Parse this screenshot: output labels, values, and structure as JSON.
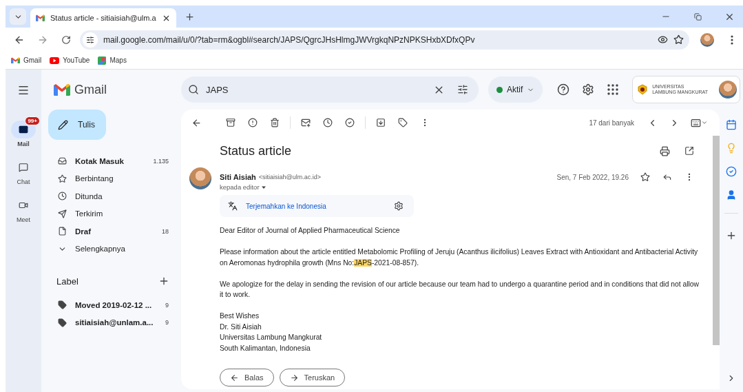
{
  "browser": {
    "tab_title": "Status article - sitiaisiah@ulm.a",
    "url": "mail.google.com/mail/u/0/?tab=rm&ogbl#search/JAPS/QgrcJHsHlmgJWVrgkqNPzNPKSHxbXDfxQPv",
    "bookmarks": [
      {
        "label": "Gmail",
        "kind": "gmail"
      },
      {
        "label": "YouTube",
        "kind": "youtube"
      },
      {
        "label": "Maps",
        "kind": "maps"
      }
    ]
  },
  "app": {
    "name": "Gmail"
  },
  "rail": [
    {
      "label": "Mail",
      "kind": "mail",
      "selected": true,
      "badge": "99+"
    },
    {
      "label": "Chat",
      "kind": "chat",
      "selected": false
    },
    {
      "label": "Meet",
      "kind": "meet",
      "selected": false
    }
  ],
  "compose": "Tulis",
  "folders": [
    {
      "label": "Kotak Masuk",
      "kind": "inbox",
      "count": "1.135",
      "unread": true
    },
    {
      "label": "Berbintang",
      "kind": "starred",
      "unread": false
    },
    {
      "label": "Ditunda",
      "kind": "snoozed",
      "unread": false
    },
    {
      "label": "Terkirim",
      "kind": "sent",
      "unread": false
    },
    {
      "label": "Draf",
      "kind": "drafts",
      "count": "18",
      "unread": true
    },
    {
      "label": "Selengkapnya",
      "kind": "more",
      "unread": false
    }
  ],
  "labels_heading": "Label",
  "labels": [
    {
      "label": "Moved 2019-02-12 ...",
      "count": "9",
      "unread": true
    },
    {
      "label": "sitiaisiah@unlam.a...",
      "count": "9",
      "unread": true
    }
  ],
  "search": {
    "value": "JAPS"
  },
  "status": {
    "label": "Aktif"
  },
  "org_logo": [
    "UNIVERSITAS",
    "LAMBUNG MANGKURAT"
  ],
  "thread": {
    "position": "17 dari banyak",
    "subject": "Status article"
  },
  "message": {
    "sender": "Siti Aisiah",
    "email": "<sitiaisiah@ulm.ac.id>",
    "to": "kepada editor",
    "date": "Sen, 7 Feb 2022, 19.26",
    "translate": "Terjemahkan ke Indonesia",
    "paragraphs": [
      [
        {
          "text": "Dear Editor of Journal of Applied Pharmaceutical Science",
          "highlight": false
        }
      ],
      [
        {
          "text": "Please information about the article entitled Metabolomic Profiling of Jeruju (Acanthus ilicifolius) Leaves Extract with Antioxidant and Antibacterial Activity on Aeromonas hydrophila growth (Mns No:",
          "highlight": false
        },
        {
          "text": "JAPS",
          "highlight": true
        },
        {
          "text": "-2021-08-857).",
          "highlight": false
        }
      ],
      [
        {
          "text": "We apologize for the delay in sending the revision of our article because our team had to undergo a quarantine period and in conditions that did not allow it to work.",
          "highlight": false
        }
      ]
    ],
    "signature": [
      "Best Wishes",
      "Dr. Siti Aisiah",
      "Universitas Lambung Mangkurat",
      "South Kalimantan, Indonesia"
    ]
  },
  "actions": [
    {
      "label": "Balas",
      "kind": "reply"
    },
    {
      "label": "Teruskan",
      "kind": "forward"
    }
  ]
}
